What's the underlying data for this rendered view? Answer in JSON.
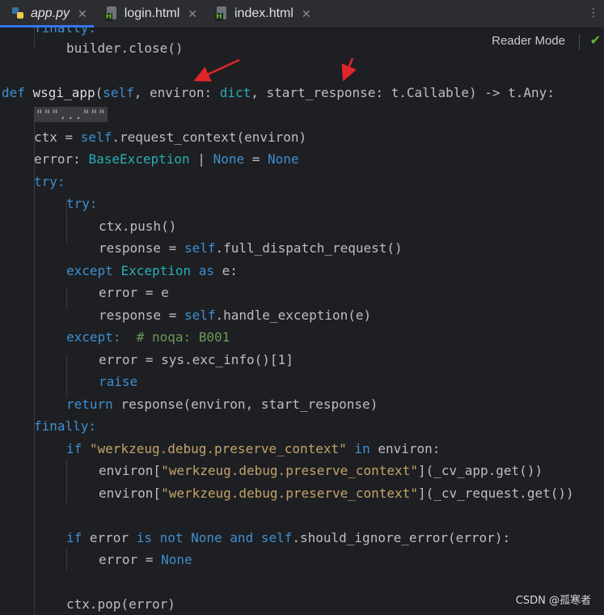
{
  "tabs": [
    {
      "label": "app.py",
      "icon": "python-file-icon",
      "close": "✕",
      "active": true
    },
    {
      "label": "login.html",
      "icon": "html-file-icon",
      "close": "✕",
      "active": false
    },
    {
      "label": "index.html",
      "icon": "html-file-icon",
      "close": "✕",
      "active": false
    }
  ],
  "tab_more": "⋮",
  "reader_mode": "Reader Mode",
  "check_glyph": "✔",
  "watermark": "CSDN @孤寒者",
  "arrow_color": "#e0262a",
  "code": {
    "l0": "finally:",
    "l1": "builder.close()",
    "l3a": "def ",
    "l3b": "wsgi_app",
    "l3c": "(",
    "l3d": "self",
    "l3e": ", environ: ",
    "l3f": "dict",
    "l3g": ", start_response: t.Callable) -> t.Any:",
    "l4": "\"\"\"...\"\"\"",
    "l5a": "ctx = ",
    "l5b": "self",
    "l5c": ".request_context(environ)",
    "l6a": "error: ",
    "l6b": "BaseException",
    "l6c": " | ",
    "l6d": "None",
    "l6e": " = ",
    "l6f": "None",
    "l7": "try:",
    "l8": "try:",
    "l9": "ctx.push()",
    "l10a": "response = ",
    "l10b": "self",
    "l10c": ".full_dispatch_request()",
    "l11a": "except ",
    "l11b": "Exception",
    "l11c": " as ",
    "l11d": "e:",
    "l12": "error = e",
    "l13a": "response = ",
    "l13b": "self",
    "l13c": ".handle_exception(e)",
    "l14a": "except:",
    "l14b": "  # noqa: B001",
    "l15": "error = sys.exc_info()[1]",
    "l16": "raise",
    "l17a": "return ",
    "l17b": "response(environ, start_response)",
    "l18": "finally:",
    "l19a": "if ",
    "l19b": "\"werkzeug.debug.preserve_context\"",
    "l19c": " in ",
    "l19d": "environ:",
    "l20a": "environ[",
    "l20b": "\"werkzeug.debug.preserve_context\"",
    "l20c": "](_cv_app.get())",
    "l21a": "environ[",
    "l21b": "\"werkzeug.debug.preserve_context\"",
    "l21c": "](_cv_request.get())",
    "l23a": "if ",
    "l23b": "error ",
    "l23c": "is not None and ",
    "l23d": "self",
    "l23e": ".should_ignore_error(error):",
    "l24a": "error = ",
    "l24b": "None",
    "l26": "ctx.pop(error)"
  }
}
